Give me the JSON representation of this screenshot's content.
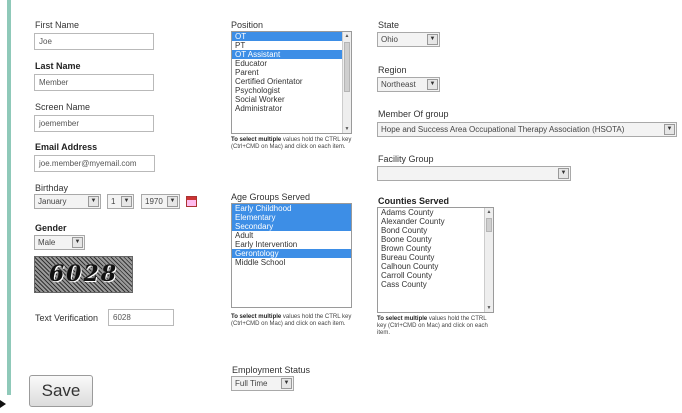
{
  "form": {
    "first_name": {
      "label": "First Name",
      "value": "Joe"
    },
    "last_name": {
      "label": "Last Name",
      "value": "Member"
    },
    "screen_name": {
      "label": "Screen Name",
      "value": "joemember"
    },
    "email": {
      "label": "Email Address",
      "value": "joe.member@myemail.com"
    },
    "birthday": {
      "label": "Birthday",
      "month": "January",
      "day": "1",
      "year": "1970"
    },
    "gender": {
      "label": "Gender",
      "value": "Male"
    },
    "text_verification": {
      "label": "Text Verification",
      "value": "6028",
      "captcha_text": "6028"
    },
    "save_label": "Save"
  },
  "position": {
    "label": "Position",
    "options": [
      {
        "label": "OT",
        "selected": true
      },
      {
        "label": "PT",
        "selected": false
      },
      {
        "label": "OT Assistant",
        "selected": true
      },
      {
        "label": "Educator",
        "selected": false
      },
      {
        "label": "Parent",
        "selected": false
      },
      {
        "label": "Certified Orientator",
        "selected": false
      },
      {
        "label": "Psychologist",
        "selected": false
      },
      {
        "label": "Social Worker",
        "selected": false
      },
      {
        "label": "Administrator",
        "selected": false
      }
    ],
    "hint_bold": "To select multiple",
    "hint_rest": " values hold the CTRL key (Ctrl+CMD on Mac) and click on each item."
  },
  "age_groups": {
    "label": "Age Groups Served",
    "options": [
      {
        "label": "Early Childhood",
        "selected": true
      },
      {
        "label": "Elementary",
        "selected": true
      },
      {
        "label": "Secondary",
        "selected": true
      },
      {
        "label": "Adult",
        "selected": false
      },
      {
        "label": "Early Intervention",
        "selected": false
      },
      {
        "label": "Gerontology",
        "selected": true
      },
      {
        "label": "Middle School",
        "selected": false
      }
    ],
    "hint_bold": "To select multiple",
    "hint_rest": " values hold the CTRL key (Ctrl+CMD on Mac) and click on each item."
  },
  "employment_status": {
    "label": "Employment Status",
    "value": "Full Time"
  },
  "state": {
    "label": "State",
    "value": "Ohio"
  },
  "region": {
    "label": "Region",
    "value": "Northeast"
  },
  "member_of": {
    "label": "Member Of group",
    "value": "Hope and Success Area Occupational Therapy Association (HSOTA)"
  },
  "facility_group": {
    "label": "Facility Group",
    "value": ""
  },
  "counties": {
    "label": "Counties Served",
    "options": [
      {
        "label": "Adams County"
      },
      {
        "label": "Alexander County"
      },
      {
        "label": "Bond County"
      },
      {
        "label": "Boone County"
      },
      {
        "label": "Brown County"
      },
      {
        "label": "Bureau County"
      },
      {
        "label": "Calhoun County"
      },
      {
        "label": "Carroll County"
      },
      {
        "label": "Cass County"
      }
    ],
    "hint_bold": "To select multiple",
    "hint_rest": " values hold the CTRL key (Ctrl+CMD on Mac) and click on each item."
  },
  "colors": {
    "accent_bar": "#8fc9b9",
    "selection": "#3d8ee6"
  }
}
